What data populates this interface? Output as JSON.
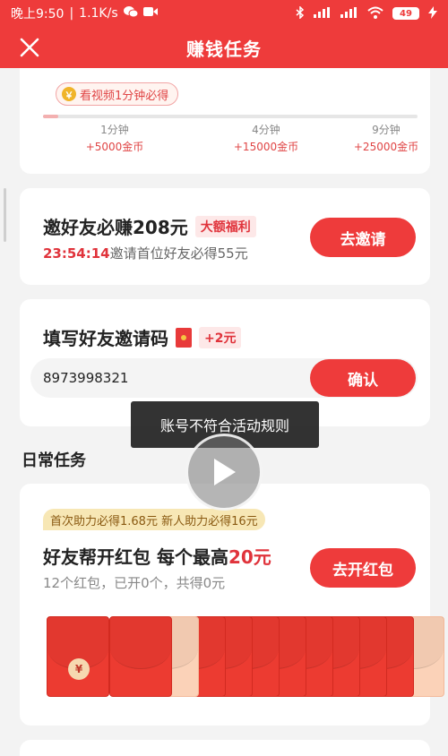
{
  "status_bar": {
    "time": "晚上9:50",
    "net_speed": "1.1K/s",
    "battery": "49",
    "colors": {
      "accent": "#ee3b3b"
    }
  },
  "header": {
    "title": "赚钱任务"
  },
  "video_reward": {
    "tip": "看视频1分钟必得",
    "progress_fraction": 0.04,
    "milestones": [
      {
        "time": "1分钟",
        "reward": "+5000金币"
      },
      {
        "time": "4分钟",
        "reward": "+15000金币"
      },
      {
        "time": "9分钟",
        "reward": "+25000金币"
      }
    ]
  },
  "invite": {
    "title": "邀好友必赚208元",
    "tag": "大额福利",
    "countdown": "23:54:14",
    "subtitle": "邀请首位好友必得55元",
    "button": "去邀请"
  },
  "code_entry": {
    "title": "填写好友邀请码",
    "bonus": "+2元",
    "value": "8973998321",
    "button": "确认"
  },
  "toast": {
    "text": "账号不符合活动规则"
  },
  "daily": {
    "section_title": "日常任务"
  },
  "red_packet_task": {
    "tag": "首次助力必得1.68元 新人助力必得16元",
    "title_prefix": "好友帮开红包 每个最高",
    "title_amount": "20元",
    "subtitle": "12个红包，已开0个，共得0元",
    "button": "去开红包",
    "seal_symbol": "¥"
  }
}
